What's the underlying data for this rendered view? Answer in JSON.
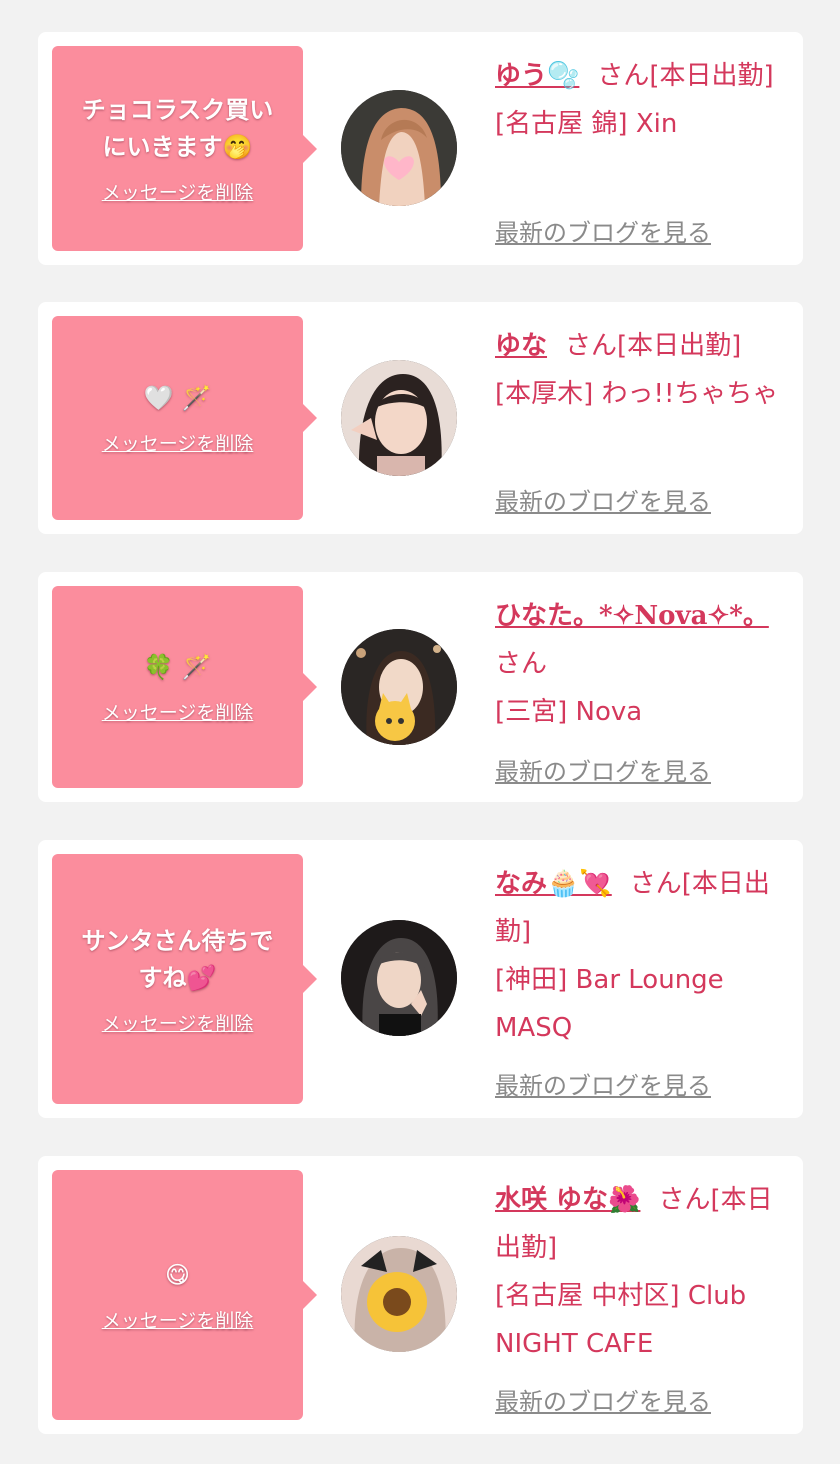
{
  "delete_label": "メッセージを削除",
  "blog_label": "最新のブログを見る",
  "san_suffix": "さん",
  "cards": [
    {
      "message": "チョコラスク買い\nにいきます🤭",
      "name": "ゆう🫧",
      "status": "[本日出勤]",
      "shop": "[名古屋 錦] Xin"
    },
    {
      "message": "🤍 🪄",
      "name": "ゆな",
      "status": "[本日出勤]",
      "shop": "[本厚木] わっ!!ちゃちゃ"
    },
    {
      "message": "🍀 🪄",
      "name": "ひなた。*✧Nova✧*。",
      "status": "",
      "shop": "[三宮] Nova"
    },
    {
      "message": "サンタさん待ちで\nすね💕",
      "name": "なみ🧁💘",
      "status": "[本日出勤]",
      "shop": "[神田] Bar Lounge MASQ"
    },
    {
      "message": "😋 ",
      "name": "水咲 ゆな🌺",
      "status": "[本日出勤]",
      "shop": "[名古屋 中村区] Club NIGHT CAFE"
    }
  ],
  "colors": {
    "page_bg": "#f2f2f2",
    "bubble": "#fb8d9d",
    "name": "#d4385c",
    "link_gray": "#8a8a8a"
  }
}
